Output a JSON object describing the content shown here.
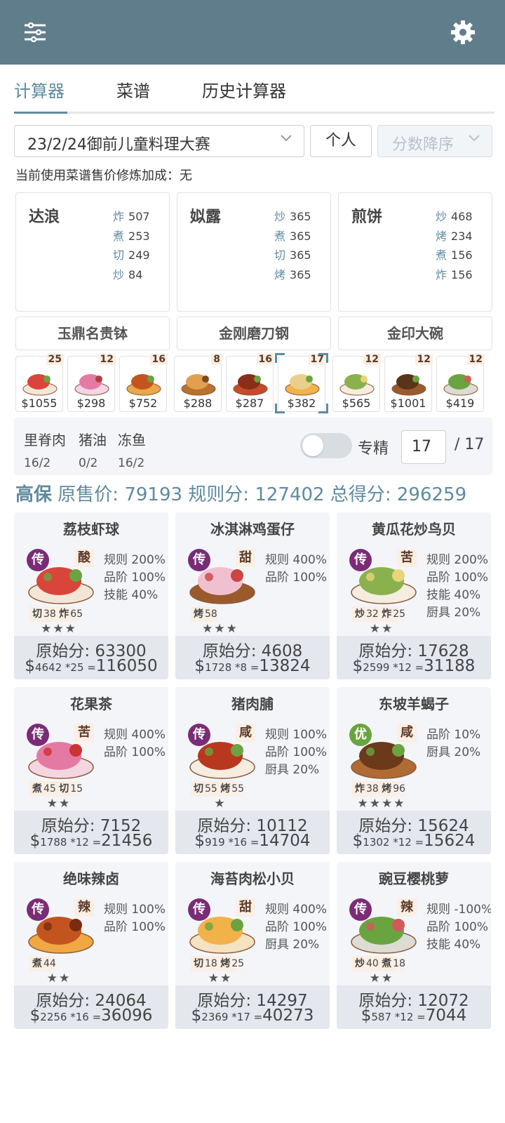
{
  "header": {
    "filter_icon": "sliders-icon",
    "settings_icon": "gear-icon"
  },
  "tabs": [
    {
      "label": "计算器"
    },
    {
      "label": "菜谱"
    },
    {
      "label": "历史计算器"
    }
  ],
  "controls": {
    "contest": "23/2/24御前儿童料理大赛",
    "mode": "个人",
    "sort": "分数降序"
  },
  "note": "当前使用菜谱售价修炼加成：无",
  "chefs": [
    {
      "name": "达浪",
      "skills": [
        {
          "k": "炸",
          "v": "507"
        },
        {
          "k": "煮",
          "v": "253"
        },
        {
          "k": "切",
          "v": "249"
        },
        {
          "k": "炒",
          "v": "84"
        }
      ],
      "equip": "玉鼎名贵钵"
    },
    {
      "name": "姒露",
      "skills": [
        {
          "k": "炒",
          "v": "365"
        },
        {
          "k": "煮",
          "v": "365"
        },
        {
          "k": "切",
          "v": "365"
        },
        {
          "k": "烤",
          "v": "365"
        }
      ],
      "equip": "金刚磨刀钢"
    },
    {
      "name": "煎饼",
      "skills": [
        {
          "k": "炒",
          "v": "468"
        },
        {
          "k": "烤",
          "v": "234"
        },
        {
          "k": "煮",
          "v": "156"
        },
        {
          "k": "炸",
          "v": "156"
        }
      ],
      "equip": "金印大碗"
    }
  ],
  "dish_strip": [
    {
      "count": "25",
      "price": "$1055"
    },
    {
      "count": "12",
      "price": "$298"
    },
    {
      "count": "16",
      "price": "$752"
    },
    {
      "count": "8",
      "price": "$288"
    },
    {
      "count": "16",
      "price": "$287"
    },
    {
      "count": "17",
      "price": "$382"
    },
    {
      "count": "12",
      "price": "$565"
    },
    {
      "count": "12",
      "price": "$1001"
    },
    {
      "count": "12",
      "price": "$419"
    }
  ],
  "ingredients": [
    {
      "name": "里脊肉",
      "qty": "16/2"
    },
    {
      "name": "猪油",
      "qty": "0/2"
    },
    {
      "name": "冻鱼",
      "qty": "16/2"
    }
  ],
  "specialize": {
    "label": "专精",
    "value": "17",
    "max": "/ 17",
    "enabled": false
  },
  "summary": {
    "level": "高保",
    "price_label": "原售价:",
    "price": "79193",
    "rule_label": "规则分:",
    "rule": "127402",
    "total_label": "总得分:",
    "total": "296259"
  },
  "cards": [
    {
      "title": "荔枝虾球",
      "rare": "传",
      "taste": "酸",
      "skills": [
        {
          "k": "切",
          "v": "38"
        },
        {
          "k": "炸",
          "v": "65"
        }
      ],
      "stars": "★★★",
      "bonus": [
        "规则 200%",
        "品阶 100%",
        "技能 40%"
      ],
      "raw": "原始分: 63300",
      "price": "4642",
      "mult": "*25",
      "total": "116050"
    },
    {
      "title": "冰淇淋鸡蛋仔",
      "rare": "传",
      "taste": "甜",
      "skills": [
        {
          "k": "烤",
          "v": "58"
        }
      ],
      "stars": "★★★",
      "bonus": [
        "规则 400%",
        "品阶 100%"
      ],
      "raw": "原始分: 4608",
      "price": "1728",
      "mult": "*8",
      "total": "13824"
    },
    {
      "title": "黄瓜花炒鸟贝",
      "rare": "传",
      "taste": "苦",
      "skills": [
        {
          "k": "炒",
          "v": "32"
        },
        {
          "k": "炸",
          "v": "25"
        }
      ],
      "stars": "★★",
      "bonus": [
        "规则 200%",
        "品阶 100%",
        "技能 40%",
        "厨具 20%"
      ],
      "raw": "原始分: 17628",
      "price": "2599",
      "mult": "*12",
      "total": "31188"
    },
    {
      "title": "花果茶",
      "rare": "传",
      "taste": "苦",
      "skills": [
        {
          "k": "煮",
          "v": "45"
        },
        {
          "k": "切",
          "v": "15"
        }
      ],
      "stars": "★★",
      "bonus": [
        "规则 400%",
        "品阶 100%"
      ],
      "raw": "原始分: 7152",
      "price": "1788",
      "mult": "*12",
      "total": "21456"
    },
    {
      "title": "猪肉脯",
      "rare": "传",
      "taste": "咸",
      "skills": [
        {
          "k": "切",
          "v": "55"
        },
        {
          "k": "烤",
          "v": "55"
        }
      ],
      "stars": "★",
      "bonus": [
        "规则 100%",
        "品阶 100%",
        "厨具 20%"
      ],
      "raw": "原始分: 10112",
      "price": "919",
      "mult": "*16",
      "total": "14704"
    },
    {
      "title": "东坡羊蝎子",
      "rare": "优",
      "taste": "咸",
      "skills": [
        {
          "k": "炸",
          "v": "38"
        },
        {
          "k": "烤",
          "v": "96"
        }
      ],
      "stars": "★★★★",
      "bonus": [
        "品阶 10%",
        "厨具 20%"
      ],
      "raw": "原始分: 15624",
      "price": "1302",
      "mult": "*12",
      "total": "15624"
    },
    {
      "title": "绝味辣卤",
      "rare": "传",
      "taste": "辣",
      "skills": [
        {
          "k": "煮",
          "v": "44"
        }
      ],
      "stars": "★★",
      "bonus": [
        "规则 100%",
        "品阶 100%"
      ],
      "raw": "原始分: 24064",
      "price": "2256",
      "mult": "*16",
      "total": "36096"
    },
    {
      "title": "海苔肉松小贝",
      "rare": "传",
      "taste": "甜",
      "skills": [
        {
          "k": "切",
          "v": "18"
        },
        {
          "k": "烤",
          "v": "25"
        }
      ],
      "stars": "★★",
      "bonus": [
        "规则 400%",
        "品阶 100%",
        "厨具 20%"
      ],
      "raw": "原始分: 14297",
      "price": "2369",
      "mult": "*17",
      "total": "40273"
    },
    {
      "title": "豌豆樱桃萝",
      "rare": "传",
      "taste": "辣",
      "skills": [
        {
          "k": "炒",
          "v": "40"
        },
        {
          "k": "煮",
          "v": "18"
        }
      ],
      "stars": "★★",
      "bonus": [
        "规则 -100%",
        "品阶 100%",
        "技能 40%"
      ],
      "raw": "原始分: 12072",
      "price": "587",
      "mult": "*12",
      "total": "7044"
    }
  ]
}
